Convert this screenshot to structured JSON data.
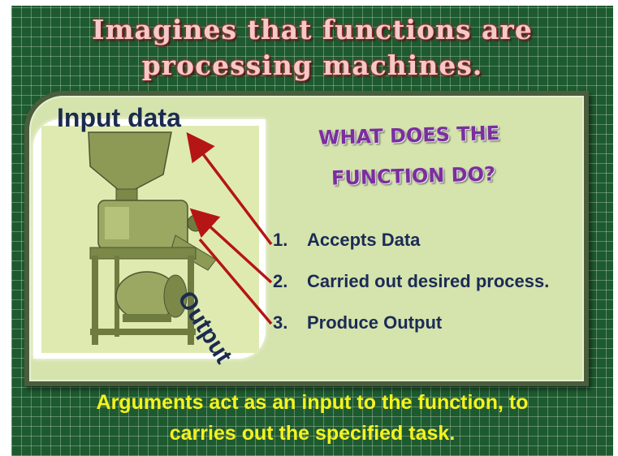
{
  "slide": {
    "title_line1": "Imagines that functions are",
    "title_line2": "processing machines.",
    "input_label": "Input data",
    "output_label": "Output",
    "question_line1": "WHAT DOES THE",
    "question_line2": "FUNCTION DO?",
    "steps": [
      {
        "num": "1.",
        "text": "Accepts Data"
      },
      {
        "num": "2.",
        "text": "Carried out desired process."
      },
      {
        "num": "3.",
        "text": "Produce Output"
      }
    ],
    "footer_line1": "Arguments act as an input to the function, to",
    "footer_line2": "carries out the specified task."
  },
  "colors": {
    "background": "#1e5a2f",
    "panel": "#d5e3ad",
    "title": "#f6c9c9",
    "question": "#7b2ea0",
    "steps": "#1b2b55",
    "footer": "#f5f21e",
    "arrow": "#b51515"
  },
  "icons": {
    "machine": "grain-mill-machine-image",
    "arrow": "red-arrow"
  }
}
